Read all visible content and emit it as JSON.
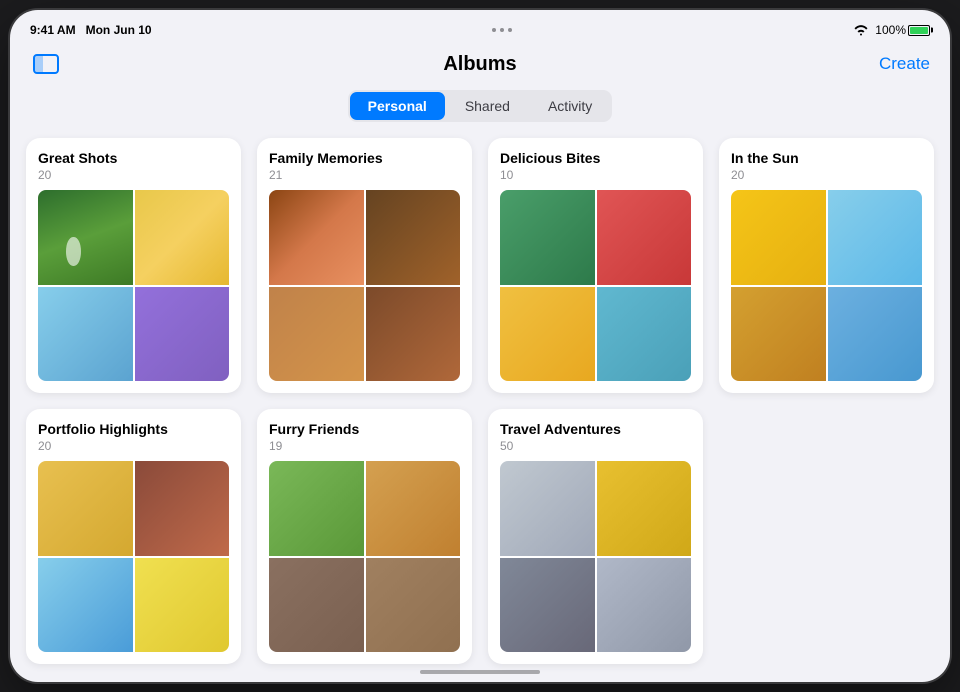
{
  "statusBar": {
    "time": "9:41 AM",
    "date": "Mon Jun 10",
    "battery": "100%",
    "dots": [
      "•",
      "•",
      "•"
    ]
  },
  "header": {
    "title": "Albums",
    "createLabel": "Create",
    "sidebarIcon": "sidebar-icon"
  },
  "tabs": [
    {
      "id": "personal",
      "label": "Personal",
      "active": true
    },
    {
      "id": "shared",
      "label": "Shared",
      "active": false
    },
    {
      "id": "activity",
      "label": "Activity",
      "active": false
    }
  ],
  "albums": [
    {
      "id": "great-shots",
      "title": "Great Shots",
      "count": "20",
      "colors": [
        "gs1",
        "gs2",
        "gs3",
        "gs4"
      ]
    },
    {
      "id": "family-memories",
      "title": "Family Memories",
      "count": "21",
      "colors": [
        "fm1",
        "fm2",
        "fm3",
        "fm4"
      ]
    },
    {
      "id": "delicious-bites",
      "title": "Delicious Bites",
      "count": "10",
      "colors": [
        "db1",
        "db2",
        "db3",
        "db4"
      ]
    },
    {
      "id": "in-the-sun",
      "title": "In the Sun",
      "count": "20",
      "colors": [
        "is1",
        "is2",
        "is3",
        "is4"
      ]
    },
    {
      "id": "portfolio-highlights",
      "title": "Portfolio Highlights",
      "count": "20",
      "colors": [
        "ph1",
        "ph2",
        "ph3",
        "ph4"
      ]
    },
    {
      "id": "furry-friends",
      "title": "Furry Friends",
      "count": "19",
      "colors": [
        "ff1",
        "ff2",
        "ff3",
        "ff4"
      ]
    },
    {
      "id": "travel-adventures",
      "title": "Travel Adventures",
      "count": "50",
      "colors": [
        "ta1",
        "ta2",
        "ta3",
        "ta4"
      ]
    }
  ]
}
